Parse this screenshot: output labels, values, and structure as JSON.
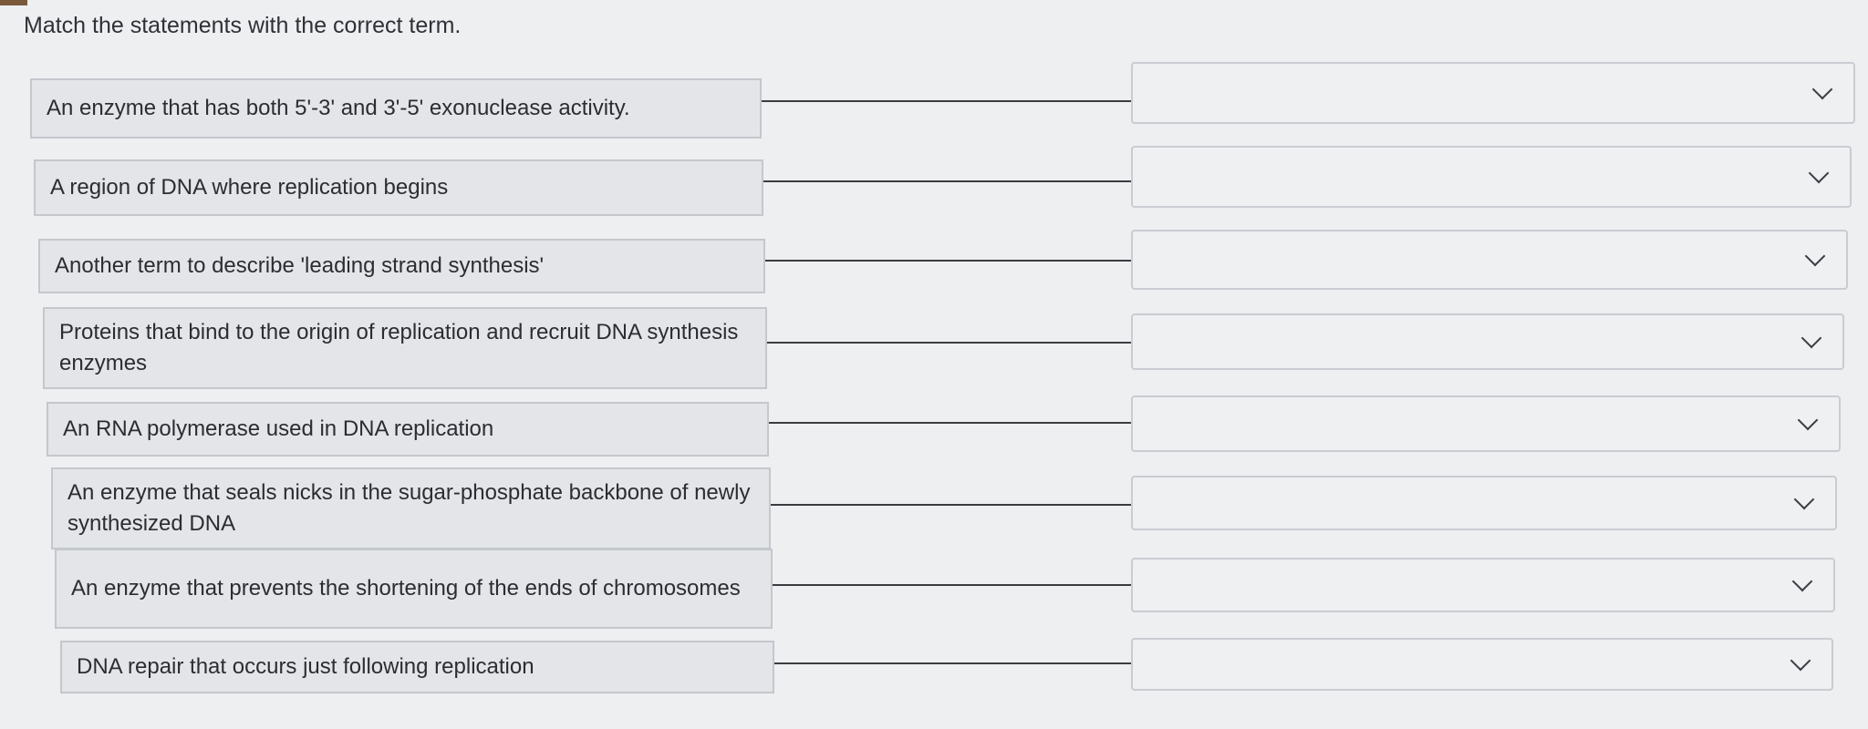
{
  "instructions": "Match the statements with the correct term.",
  "rows": [
    {
      "statement": "An enzyme that has both 5'-3' and 3'-5' exonuclease activity.",
      "selected": ""
    },
    {
      "statement": "A region of DNA where replication begins",
      "selected": ""
    },
    {
      "statement": "Another term to describe 'leading strand synthesis'",
      "selected": ""
    },
    {
      "statement": "Proteins that bind to the origin of replication and recruit DNA synthesis enzymes",
      "selected": ""
    },
    {
      "statement": "An RNA polymerase used in DNA replication",
      "selected": ""
    },
    {
      "statement": "An enzyme that seals nicks in the sugar-phosphate backbone of newly synthesized DNA",
      "selected": ""
    },
    {
      "statement": "An enzyme that prevents the shortening of the ends of chromosomes",
      "selected": ""
    },
    {
      "statement": "DNA repair that occurs just following replication",
      "selected": ""
    }
  ],
  "icons": {
    "dropdown": "chevron-down-icon"
  }
}
